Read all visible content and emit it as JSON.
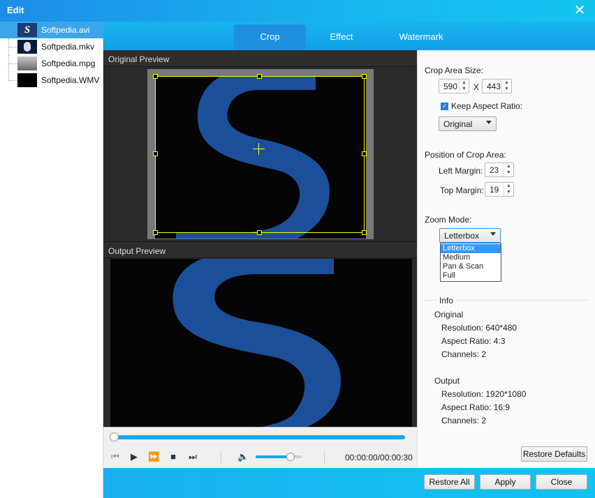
{
  "window": {
    "title": "Edit"
  },
  "files": [
    {
      "name": "Softpedia.avi",
      "selected": true
    },
    {
      "name": "Softpedia.mkv",
      "selected": false
    },
    {
      "name": "Softpedia.mpg",
      "selected": false
    },
    {
      "name": "Softpedia.WMV",
      "selected": false
    }
  ],
  "tabs": {
    "crop": "Crop",
    "effect": "Effect",
    "watermark": "Watermark"
  },
  "preview": {
    "original_label": "Original Preview",
    "output_label": "Output Preview"
  },
  "player": {
    "time": "00:00:00/00:00:30",
    "progress": 0.0,
    "volume": 0.75
  },
  "crop": {
    "area_size_label": "Crop Area Size:",
    "width": "590",
    "x_sep": "X",
    "height": "443",
    "keep_aspect_label": "Keep Aspect Ratio:",
    "keep_aspect_checked": true,
    "aspect_option": "Original",
    "position_label": "Position of Crop Area:",
    "left_margin_label": "Left Margin:",
    "left_margin": "23",
    "top_margin_label": "Top Margin:",
    "top_margin": "19",
    "zoom_label": "Zoom Mode:",
    "zoom_value": "Letterbox",
    "zoom_options": [
      "Letterbox",
      "Medium",
      "Pan & Scan",
      "Full"
    ]
  },
  "info": {
    "heading": "Info",
    "original_heading": "Original",
    "original_resolution": "Resolution: 640*480",
    "original_aspect": "Aspect Ratio: 4:3",
    "original_channels": "Channels: 2",
    "output_heading": "Output",
    "output_resolution": "Resolution: 1920*1080",
    "output_aspect": "Aspect Ratio: 16:9",
    "output_channels": "Channels: 2"
  },
  "buttons": {
    "restore_defaults": "Restore Defaults",
    "restore_all": "Restore All",
    "apply": "Apply",
    "close": "Close"
  },
  "colors": {
    "accent": "#18b3ee",
    "crop_frame": "#ffff00",
    "logo_blue": "#1c4f99"
  }
}
